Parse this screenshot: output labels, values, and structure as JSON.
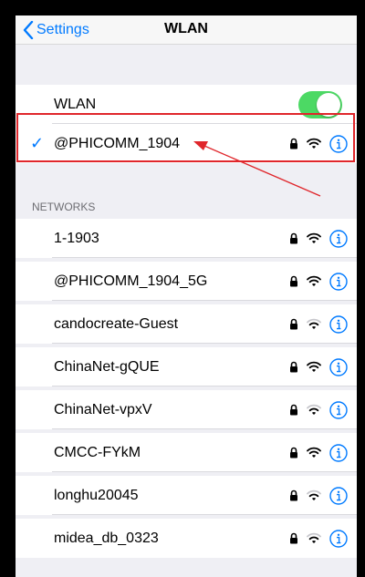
{
  "navbar": {
    "back_label": "Settings",
    "title": "WLAN"
  },
  "wlan_toggle": {
    "label": "WLAN",
    "on": true,
    "color": "#4cd964"
  },
  "connected": {
    "name": "@PHICOMM_1904",
    "check": "✓",
    "secured": true,
    "signal": "strong"
  },
  "section": {
    "networks_header": "NETWORKS"
  },
  "networks": [
    {
      "name": "1-1903",
      "secured": true,
      "signal": "strong"
    },
    {
      "name": "@PHICOMM_1904_5G",
      "secured": true,
      "signal": "strong"
    },
    {
      "name": "candocreate-Guest",
      "secured": true,
      "signal": "medium"
    },
    {
      "name": "ChinaNet-gQUE",
      "secured": true,
      "signal": "strong"
    },
    {
      "name": "ChinaNet-vpxV",
      "secured": true,
      "signal": "medium"
    },
    {
      "name": "CMCC-FYkM",
      "secured": true,
      "signal": "strong"
    },
    {
      "name": "longhu20045",
      "secured": true,
      "signal": "medium"
    },
    {
      "name": "midea_db_0323",
      "secured": true,
      "signal": "medium"
    }
  ],
  "colors": {
    "accent": "#007aff",
    "annotation": "#e0262b"
  },
  "icons": [
    "chevron-left-icon",
    "lock-icon",
    "wifi-icon",
    "info-icon",
    "checkmark-icon"
  ]
}
